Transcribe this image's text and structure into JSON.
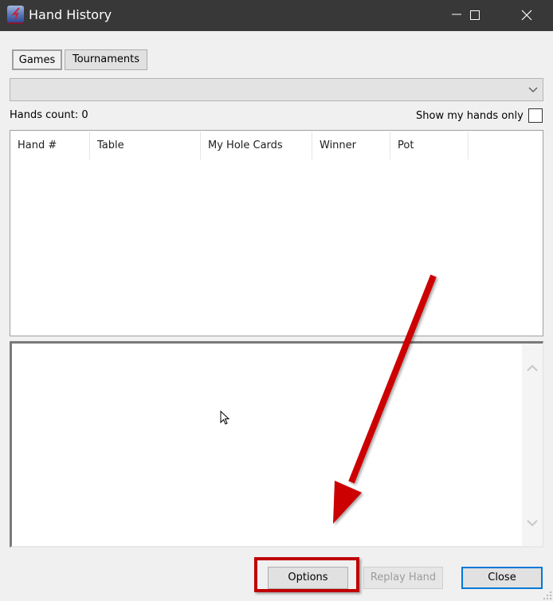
{
  "window": {
    "title": "Hand History",
    "controls": [
      "minimize",
      "maximize",
      "close"
    ]
  },
  "tabs": [
    {
      "label": "Games",
      "active": true
    },
    {
      "label": "Tournaments",
      "active": false
    }
  ],
  "filter_dropdown": {
    "selected": ""
  },
  "hands_count_label": "Hands count: 0",
  "show_my_hands_only": {
    "label": "Show my hands only",
    "checked": false
  },
  "hands_table": {
    "columns": [
      "Hand #",
      "Table",
      "My Hole Cards",
      "Winner",
      "Pot"
    ],
    "rows": []
  },
  "hand_detail_text": "",
  "buttons": {
    "options": "Options",
    "replay_hand": "Replay Hand",
    "close": "Close"
  },
  "annotation": {
    "highlight_target": "Options",
    "color": "#c00000"
  }
}
